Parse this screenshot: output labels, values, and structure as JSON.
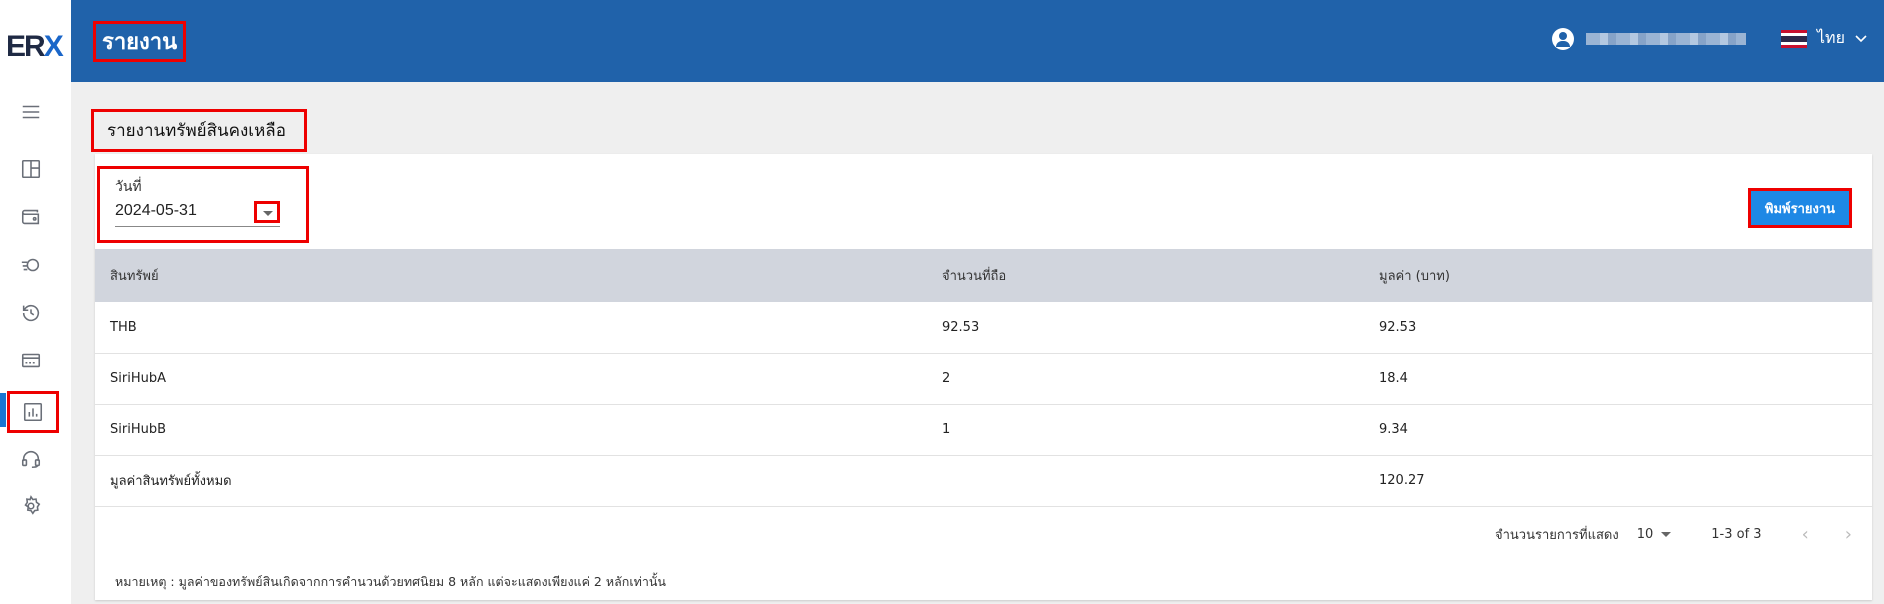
{
  "app": {
    "logo_left": "ER",
    "logo_right": "X"
  },
  "header": {
    "title": "รายงาน",
    "language": "ไทย"
  },
  "sidebar": {
    "items": [
      {
        "icon": "menu-icon"
      },
      {
        "icon": "dashboard-icon"
      },
      {
        "icon": "wallet-icon"
      },
      {
        "icon": "transfer-icon"
      },
      {
        "icon": "history-icon"
      },
      {
        "icon": "card-icon"
      },
      {
        "icon": "report-icon",
        "active": true
      },
      {
        "icon": "support-icon"
      },
      {
        "icon": "settings-icon"
      }
    ]
  },
  "page": {
    "title": "รายงานทรัพย์สินคงเหลือ"
  },
  "filter": {
    "date_label": "วันที่",
    "date_value": "2024-05-31"
  },
  "actions": {
    "print_label": "พิมพ์รายงาน"
  },
  "table": {
    "headers": [
      "สินทรัพย์",
      "จำนวนที่ถือ",
      "มูลค่า (บาท)"
    ],
    "rows": [
      [
        "THB",
        "92.53",
        "92.53"
      ],
      [
        "SiriHubA",
        "2",
        "18.4"
      ],
      [
        "SiriHubB",
        "1",
        "9.34"
      ],
      [
        "มูลค่าสินทรัพย์ทั้งหมด",
        "",
        "120.27"
      ]
    ]
  },
  "pagination": {
    "rows_per_page_label": "จำนวนรายการที่แสดง",
    "rows_per_page": "10",
    "range": "1-3 of 3"
  },
  "note": "หมายเหตุ : มูลค่าของทรัพย์สินเกิดจากการคำนวนด้วยทศนิยม 8 หลัก แต่จะแสดงเพียงแค่ 2 หลักเท่านั้น",
  "colors": {
    "header_bg": "#2062aa",
    "primary_button": "#1e88e5",
    "active_indicator": "#1976d2",
    "highlight_box": "#e00000"
  }
}
